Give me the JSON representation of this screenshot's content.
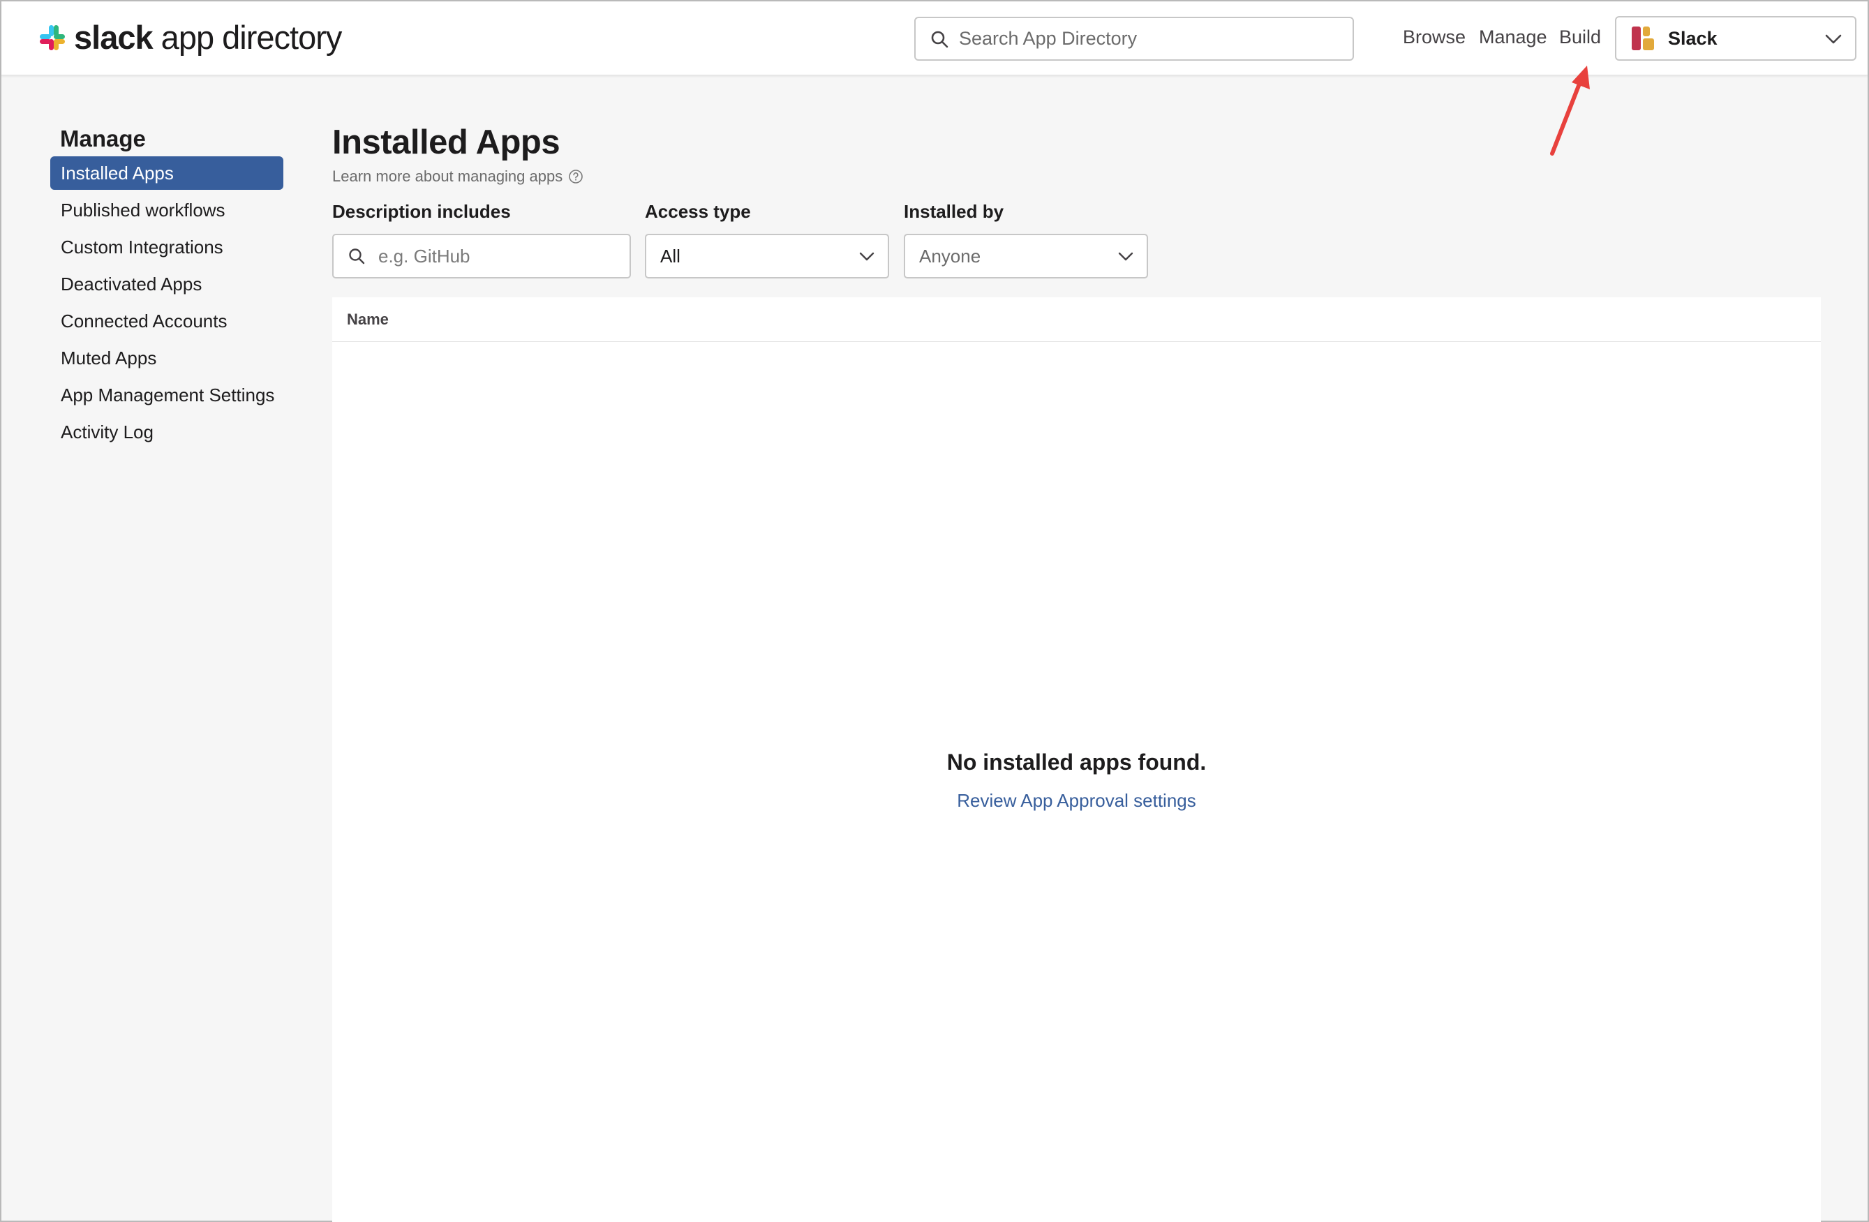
{
  "header": {
    "logo_bold": "slack",
    "logo_rest": " app directory",
    "search_placeholder": "Search App Directory",
    "nav": {
      "browse": "Browse",
      "manage": "Manage",
      "build": "Build"
    },
    "workspace": {
      "name": "Slack"
    }
  },
  "sidebar": {
    "title": "Manage",
    "items": [
      {
        "label": "Installed Apps",
        "active": true
      },
      {
        "label": "Published workflows"
      },
      {
        "label": "Custom Integrations"
      },
      {
        "label": "Deactivated Apps"
      },
      {
        "label": "Connected Accounts"
      },
      {
        "label": "Muted Apps"
      },
      {
        "label": "App Management Settings"
      },
      {
        "label": "Activity Log"
      }
    ]
  },
  "main": {
    "title": "Installed Apps",
    "learn_more": "Learn more about managing apps",
    "filters": {
      "description": {
        "label": "Description includes",
        "placeholder": "e.g. GitHub"
      },
      "access_type": {
        "label": "Access type",
        "value": "All"
      },
      "installed_by": {
        "label": "Installed by",
        "value": "Anyone"
      }
    },
    "table": {
      "columns": [
        "Name"
      ]
    },
    "empty": {
      "title": "No installed apps found.",
      "link": "Review App Approval settings"
    }
  },
  "colors": {
    "accent": "#375e9c",
    "annotation_arrow": "#e8413d"
  }
}
